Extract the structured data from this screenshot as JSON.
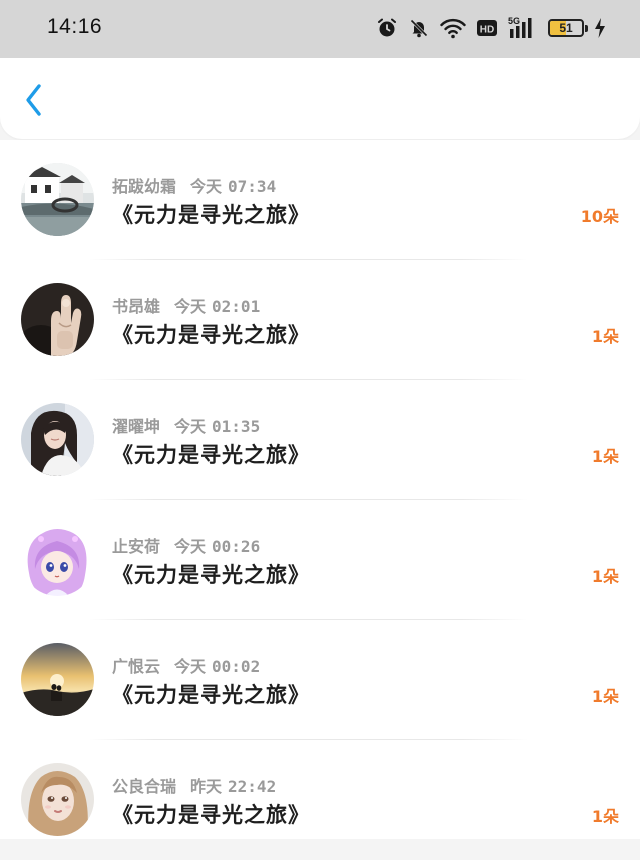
{
  "status_bar": {
    "time": "14:16",
    "network": "5G",
    "hd_label": "HD",
    "battery_percent": 51,
    "battery_label": "51",
    "icons": [
      "alarm-icon",
      "mute-icon",
      "wifi-icon",
      "hd-icon",
      "signal-5g-icon",
      "battery-icon",
      "charging-icon"
    ]
  },
  "header": {
    "back_icon": "chevron-left-icon",
    "accent_color": "#1e9ce8"
  },
  "colors": {
    "flower_count": "#f07b2c",
    "meta_text": "#9a9a9a",
    "title_text": "#1e1e1e"
  },
  "list": {
    "items": [
      {
        "name": "拓跋幼霜",
        "date": "今天",
        "time": "07:34",
        "title": "《元力是寻光之旅》",
        "flowers": "10朵",
        "avatar": "scenery-avatar"
      },
      {
        "name": "书昂雄",
        "date": "今天",
        "time": "02:01",
        "title": "《元力是寻光之旅》",
        "flowers": "1朵",
        "avatar": "hand-avatar"
      },
      {
        "name": "濯曜坤",
        "date": "今天",
        "time": "01:35",
        "title": "《元力是寻光之旅》",
        "flowers": "1朵",
        "avatar": "girl-photo-avatar"
      },
      {
        "name": "止安荷",
        "date": "今天",
        "time": "00:26",
        "title": "《元力是寻光之旅》",
        "flowers": "1朵",
        "avatar": "anime-girl-avatar"
      },
      {
        "name": "广恨云",
        "date": "今天",
        "time": "00:02",
        "title": "《元力是寻光之旅》",
        "flowers": "1朵",
        "avatar": "sunset-couple-avatar"
      },
      {
        "name": "公良合瑞",
        "date": "昨天",
        "time": "22:42",
        "title": "《元力是寻光之旅》",
        "flowers": "1朵",
        "avatar": "doll-avatar"
      }
    ]
  }
}
